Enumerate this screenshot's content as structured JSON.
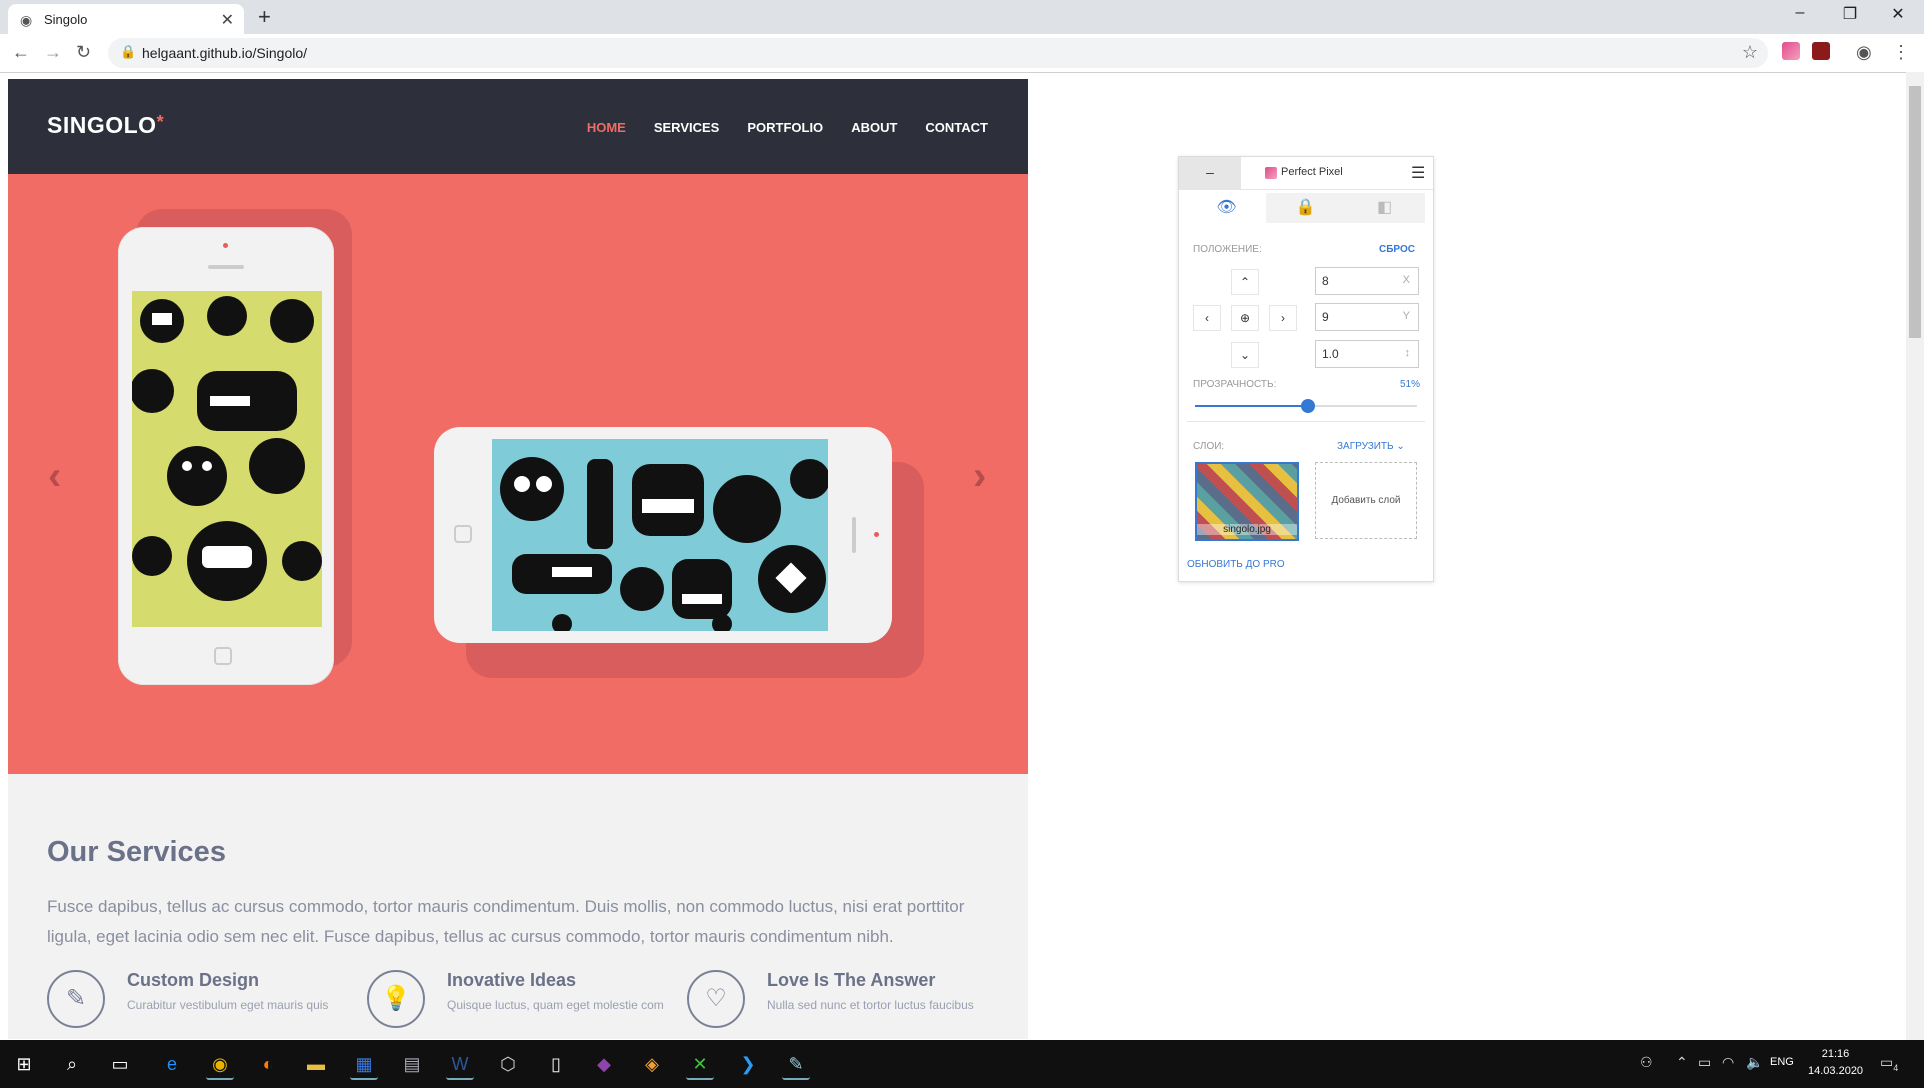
{
  "browser": {
    "tab_title": "Singolo",
    "new_tab": "+",
    "url": "helgaant.github.io/Singolo/",
    "window_buttons": [
      "–",
      "❐",
      "✕"
    ]
  },
  "site": {
    "logo": "SINGOLO",
    "logo_star": "*",
    "nav": [
      "HOME",
      "SERVICES",
      "PORTFOLIO",
      "ABOUT",
      "CONTACT"
    ],
    "active_nav": "HOME",
    "slider_prev": "‹",
    "slider_next": "›",
    "services": {
      "title": "Our Services",
      "text": "Fusce dapibus, tellus ac cursus commodo, tortor mauris condimentum. Duis mollis, non commodo luctus, nisi erat porttitor ligula, eget lacinia odio sem nec elit. Fusce dapibus, tellus ac cursus commodo, tortor mauris condimentum nibh.",
      "items": [
        {
          "name": "Custom Design",
          "desc": "Curabitur vestibulum eget mauris quis"
        },
        {
          "name": "Inovative Ideas",
          "desc": "Quisque luctus, quam eget molestie com"
        },
        {
          "name": "Love Is The Answer",
          "desc": "Nulla sed nunc et tortor luctus faucibus"
        }
      ]
    }
  },
  "perfect_pixel": {
    "minimize": "–",
    "title": "Perfect Pixel",
    "position_label": "ПОЛОЖЕНИЕ:",
    "reset": "СБРОС",
    "x_value": "8",
    "x_unit": "X",
    "y_value": "9",
    "y_unit": "Y",
    "scale_value": "1.0",
    "scale_unit": "↕",
    "opacity_label": "ПРОЗРАЧНОСТЬ:",
    "opacity_value": "51%",
    "opacity_level": 0.51,
    "layers_label": "СЛОИ:",
    "upload": "ЗАГРУЗИТЬ",
    "layer_name": "singolo.jpg",
    "add_layer": "Добавить слой",
    "upgrade": "ОБНОВИТЬ ДО PRO"
  },
  "taskbar": {
    "lang": "ENG",
    "time": "21:16",
    "date": "14.03.2020",
    "notifications": "4"
  },
  "colors": {
    "header_bg": "#2d303a",
    "slider_bg": "#f06c64",
    "accent_blue": "#3478d4"
  }
}
